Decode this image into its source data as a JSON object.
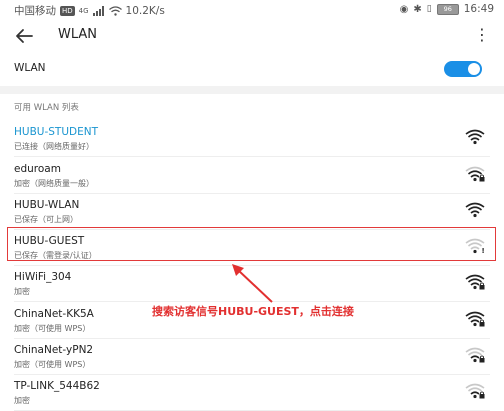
{
  "status_bar": {
    "carrier": "中国移动",
    "hd": "HD",
    "network": "4G",
    "speed": "10.2K/s",
    "battery": "96",
    "time": "16:49"
  },
  "app_bar": {
    "title": "WLAN"
  },
  "wlan_toggle": {
    "label": "WLAN",
    "on": true
  },
  "available": {
    "header": "可用 WLAN 列表",
    "networks": [
      {
        "name": "HUBU-STUDENT",
        "status": "已连接（网络质量好）",
        "active": true,
        "locked": false,
        "strength": 4
      },
      {
        "name": "eduroam",
        "status": "加密（网络质量一般）",
        "active": false,
        "locked": true,
        "strength": 3
      },
      {
        "name": "HUBU-WLAN",
        "status": "已保存（可上网）",
        "active": false,
        "locked": false,
        "strength": 4
      },
      {
        "name": "HUBU-GUEST",
        "status": "已保存（需登录/认证）",
        "active": false,
        "locked": false,
        "strength": 1,
        "warning": "!"
      },
      {
        "name": "HiWiFi_304",
        "status": "加密",
        "active": false,
        "locked": true,
        "strength": 4
      },
      {
        "name": "ChinaNet-KK5A",
        "status": "加密（可使用 WPS）",
        "active": false,
        "locked": true,
        "strength": 4
      },
      {
        "name": "ChinaNet-yPN2",
        "status": "加密（可使用 WPS）",
        "active": false,
        "locked": true,
        "strength": 2
      },
      {
        "name": "TP-LINK_544B62",
        "status": "加密",
        "active": false,
        "locked": true,
        "strength": 2
      }
    ]
  },
  "annotation": {
    "text": "搜索访客信号HUBU-GUEST，点击连接",
    "color": "#e23030"
  },
  "colors": {
    "accent": "#1a8fe6",
    "active_text": "#1a95d0",
    "highlight": "#e23a3a"
  }
}
